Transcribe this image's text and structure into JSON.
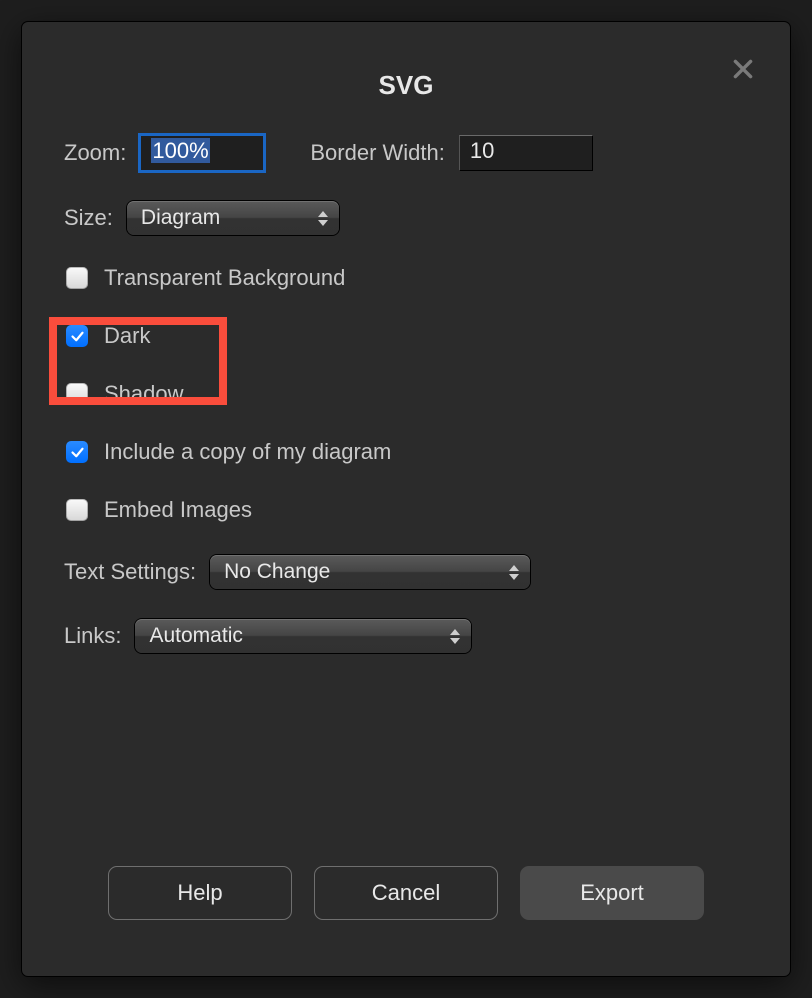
{
  "title": "SVG",
  "row1": {
    "zoom_label": "Zoom:",
    "zoom_value": "100%",
    "border_width_label": "Border Width:",
    "border_width_value": "10"
  },
  "size": {
    "label": "Size:",
    "value": "Diagram"
  },
  "checkboxes": {
    "transparent": {
      "label": "Transparent Background",
      "checked": false
    },
    "dark": {
      "label": "Dark",
      "checked": true
    },
    "shadow": {
      "label": "Shadow",
      "checked": false
    },
    "include": {
      "label": "Include a copy of my diagram",
      "checked": true
    },
    "embed": {
      "label": "Embed Images",
      "checked": false
    }
  },
  "text_settings": {
    "label": "Text Settings:",
    "value": "No Change"
  },
  "links": {
    "label": "Links:",
    "value": "Automatic"
  },
  "buttons": {
    "help": "Help",
    "cancel": "Cancel",
    "export": "Export"
  },
  "highlight_target": "dark"
}
